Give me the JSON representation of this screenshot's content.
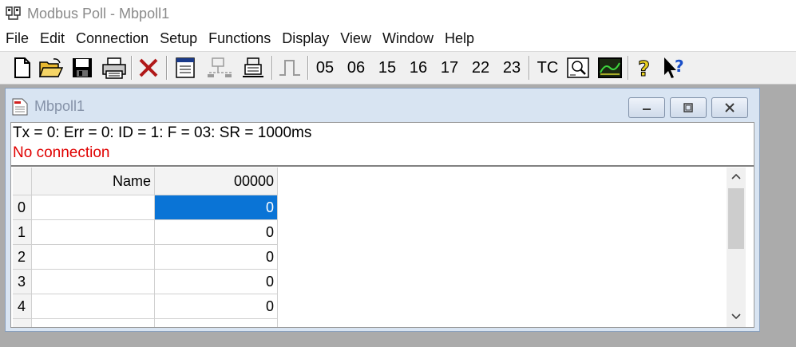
{
  "window": {
    "title": "Modbus Poll - Mbpoll1"
  },
  "menu": [
    "File",
    "Edit",
    "Connection",
    "Setup",
    "Functions",
    "Display",
    "View",
    "Window",
    "Help"
  ],
  "toolbar": {
    "function_codes": [
      "05",
      "06",
      "15",
      "16",
      "17",
      "22",
      "23"
    ],
    "tc_label": "TC",
    "icons": [
      "new-document-icon",
      "open-folder-icon",
      "save-icon",
      "print-icon",
      "close-x-icon",
      "window-icon",
      "connect-icon",
      "disconnect-icon",
      "pulse-icon",
      "traffic-monitor-icon",
      "chart-icon",
      "help-icon",
      "context-help-icon"
    ]
  },
  "child": {
    "title": "Mbpoll1",
    "status_line": "Tx = 0: Err = 0: ID = 1: F = 03: SR = 1000ms",
    "connection_status": "No connection",
    "grid": {
      "col_name_header": "Name",
      "col_address_header": "00000",
      "rows": [
        {
          "index": "0",
          "name": "",
          "value": "0"
        },
        {
          "index": "1",
          "name": "",
          "value": "0"
        },
        {
          "index": "2",
          "name": "",
          "value": "0"
        },
        {
          "index": "3",
          "name": "",
          "value": "0"
        },
        {
          "index": "4",
          "name": "",
          "value": "0"
        }
      ]
    }
  },
  "colors": {
    "selection": "#0a74d6",
    "error_text": "#e00000",
    "workspace": "#ababab"
  }
}
